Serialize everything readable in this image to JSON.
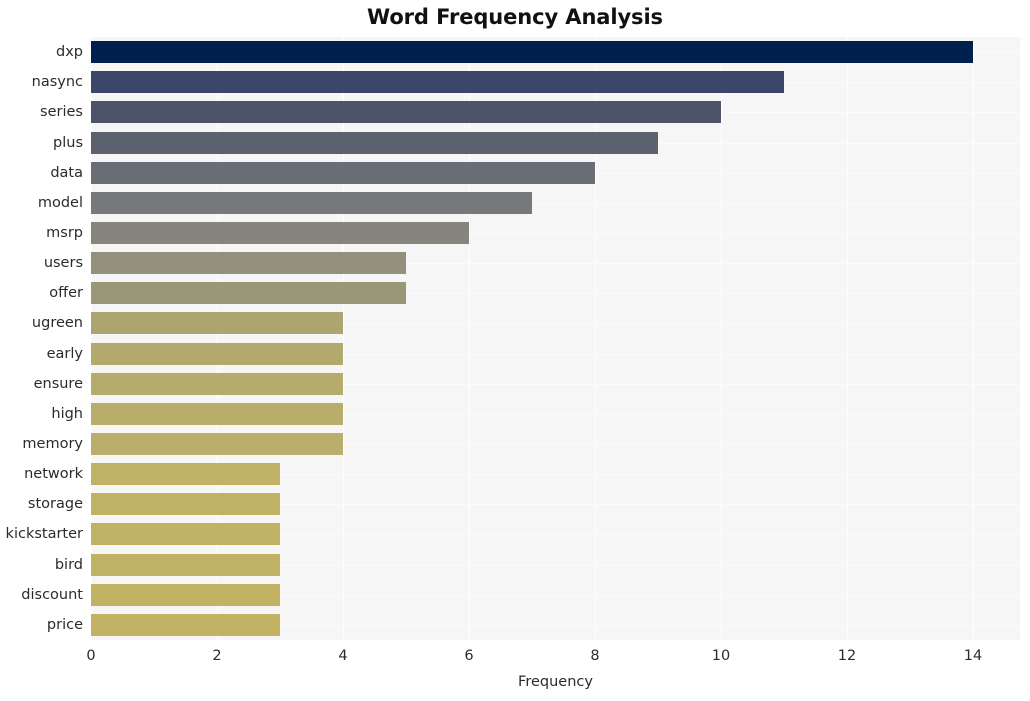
{
  "chart_data": {
    "type": "bar",
    "orientation": "horizontal",
    "title": "Word Frequency Analysis",
    "xlabel": "Frequency",
    "ylabel": "",
    "xlim": [
      0,
      14.75
    ],
    "xticks": [
      0,
      2,
      4,
      6,
      8,
      10,
      12,
      14
    ],
    "xticklabels": [
      "0",
      "2",
      "4",
      "6",
      "8",
      "10",
      "12",
      "14"
    ],
    "grid": true,
    "grid_axis": "both",
    "grid_color": "#ffffff",
    "legend": false,
    "plot_background": "#f6f6f6",
    "figure_background": "#ffffff",
    "colormap": "cividis",
    "categories": [
      "dxp",
      "nasync",
      "series",
      "plus",
      "data",
      "model",
      "msrp",
      "users",
      "offer",
      "ugreen",
      "early",
      "ensure",
      "high",
      "memory",
      "network",
      "storage",
      "kickstarter",
      "bird",
      "discount",
      "price"
    ],
    "values": [
      14,
      11,
      10,
      9,
      8,
      7,
      6,
      5,
      5,
      4,
      4,
      4,
      4,
      4,
      3,
      3,
      3,
      3,
      3,
      3
    ],
    "bar_colors": [
      "#00204d",
      "#3b4668",
      "#4d5369",
      "#5c616e",
      "#696d75",
      "#77787a",
      "#85857e",
      "#93917b",
      "#9a9779",
      "#aca471",
      "#b2a96e",
      "#b5ab6c",
      "#b8ad6b",
      "#b9ae6b",
      "#bfb165",
      "#c0b264",
      "#c0b264",
      "#c0b264",
      "#c1b363",
      "#c1b363"
    ],
    "bars": [
      {
        "label": "dxp",
        "value": 14,
        "color": "#00204d"
      },
      {
        "label": "nasync",
        "value": 11,
        "color": "#3b4668"
      },
      {
        "label": "series",
        "value": 10,
        "color": "#4d5369"
      },
      {
        "label": "plus",
        "value": 9,
        "color": "#5c616e"
      },
      {
        "label": "data",
        "value": 8,
        "color": "#696d75"
      },
      {
        "label": "model",
        "value": 7,
        "color": "#77787a"
      },
      {
        "label": "msrp",
        "value": 6,
        "color": "#85857e"
      },
      {
        "label": "users",
        "value": 5,
        "color": "#93917b"
      },
      {
        "label": "offer",
        "value": 5,
        "color": "#9a9779"
      },
      {
        "label": "ugreen",
        "value": 4,
        "color": "#aca471"
      },
      {
        "label": "early",
        "value": 4,
        "color": "#b2a96e"
      },
      {
        "label": "ensure",
        "value": 4,
        "color": "#b5ab6c"
      },
      {
        "label": "high",
        "value": 4,
        "color": "#b8ad6b"
      },
      {
        "label": "memory",
        "value": 4,
        "color": "#b9ae6b"
      },
      {
        "label": "network",
        "value": 3,
        "color": "#bfb165"
      },
      {
        "label": "storage",
        "value": 3,
        "color": "#c0b264"
      },
      {
        "label": "kickstarter",
        "value": 3,
        "color": "#c0b264"
      },
      {
        "label": "bird",
        "value": 3,
        "color": "#c0b264"
      },
      {
        "label": "discount",
        "value": 3,
        "color": "#c1b363"
      },
      {
        "label": "price",
        "value": 3,
        "color": "#c1b363"
      }
    ]
  }
}
